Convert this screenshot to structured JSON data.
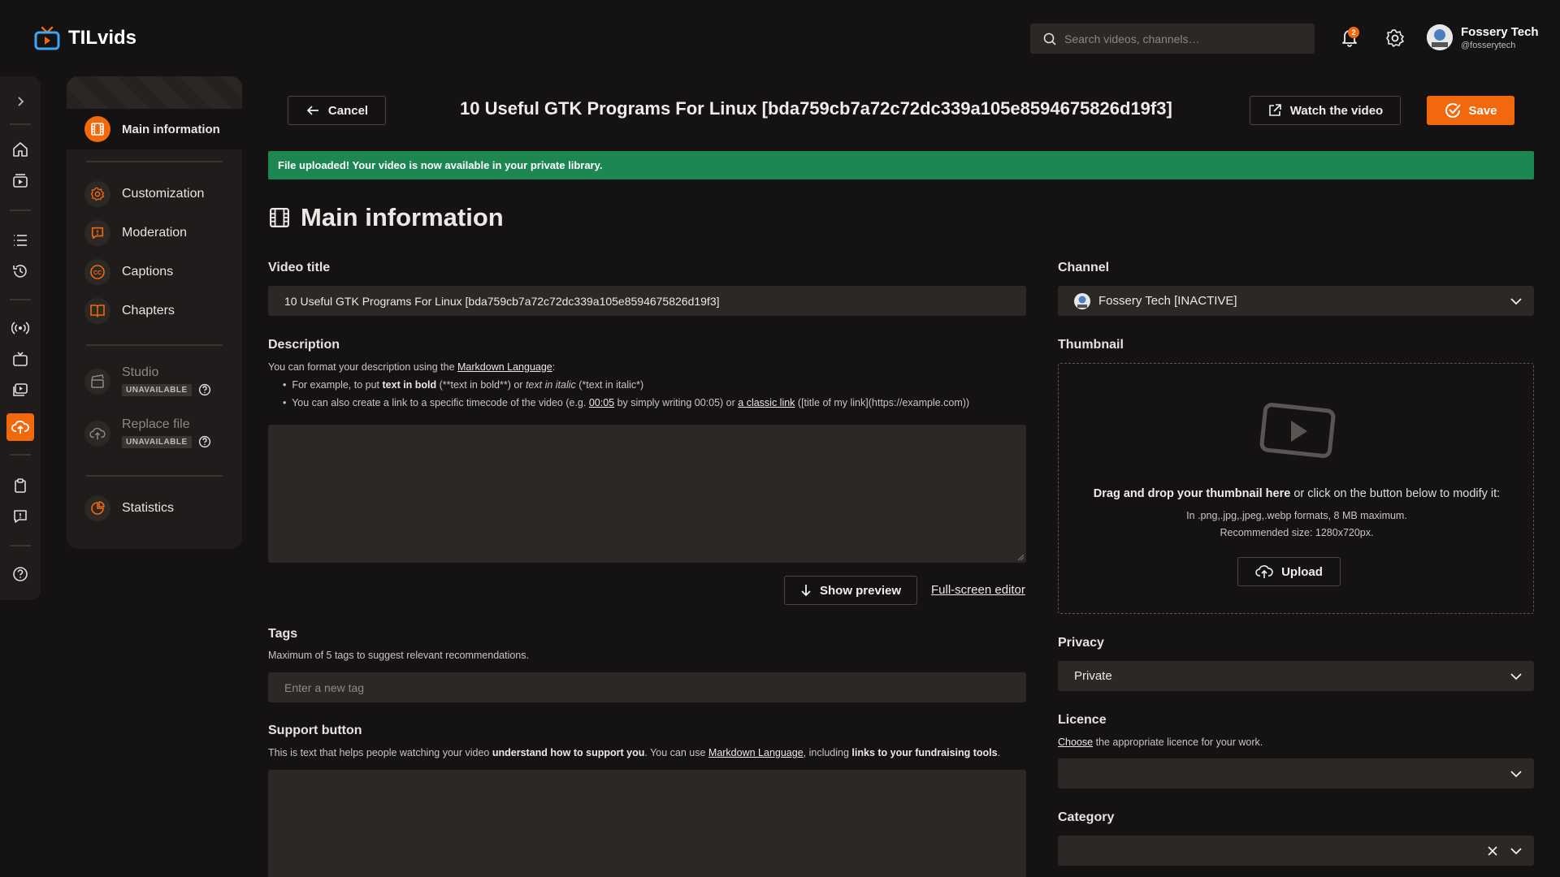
{
  "app": {
    "name": "TILvids"
  },
  "search": {
    "placeholder": "Search videos, channels…"
  },
  "notifications": {
    "count": "2"
  },
  "user": {
    "name": "Fossery Tech",
    "handle": "@fosserytech"
  },
  "submenu": {
    "main_information": "Main information",
    "customization": "Customization",
    "moderation": "Moderation",
    "captions": "Captions",
    "chapters": "Chapters",
    "studio": "Studio",
    "replace_file": "Replace file",
    "unavailable": "UNAVAILABLE",
    "statistics": "Statistics"
  },
  "header": {
    "cancel": "Cancel",
    "title": "10 Useful GTK Programs For Linux [bda759cb7a72c72dc339a105e8594675826d19f3]",
    "watch": "Watch the video",
    "save": "Save"
  },
  "alert": {
    "text": "File uploaded! Your video is now available in your private library."
  },
  "section": {
    "title": "Main information"
  },
  "form": {
    "video_title_label": "Video title",
    "video_title_value": "10 Useful GTK Programs For Linux [bda759cb7a72c72dc339a105e8594675826d19f3]",
    "description_label": "Description",
    "desc_hint_prefix": "You can format your description using the ",
    "desc_hint_link": "Markdown Language",
    "desc_hint_suffix": ":",
    "bullet1_a": "For example, to put ",
    "bullet1_bold": "text in bold",
    "bullet1_b": " (**text in bold**) or ",
    "bullet1_italic": "text in italic",
    "bullet1_c": " (*text in italic*)",
    "bullet2_a": "You can also create a link to a specific timecode of the video (e.g. ",
    "bullet2_time": "00:05",
    "bullet2_b": " by simply writing 00:05) or ",
    "bullet2_link": "a classic link",
    "bullet2_c": " ([title of my link](https://example.com))",
    "show_preview": "Show preview",
    "fullscreen_editor": "Full-screen editor",
    "tags_label": "Tags",
    "tags_hint": "Maximum of 5 tags to suggest relevant recommendations.",
    "tags_placeholder": "Enter a new tag",
    "support_label": "Support button",
    "support_a": "This is text that helps people watching your video ",
    "support_bold": "understand how to support you",
    "support_b": ". You can use ",
    "support_link": "Markdown Language",
    "support_c": ", including ",
    "support_bold2": "links to your fundraising tools",
    "support_d": "."
  },
  "right": {
    "channel_label": "Channel",
    "channel_value": "Fossery Tech [INACTIVE]",
    "thumbnail_label": "Thumbnail",
    "thumb_drag_bold": "Drag and drop your thumbnail here",
    "thumb_drag_rest": " or click on the button below to modify it:",
    "thumb_formats": "In .png,.jpg,.jpeg,.webp formats, 8 MB maximum.",
    "thumb_size": "Recommended size: 1280x720px.",
    "upload": "Upload",
    "privacy_label": "Privacy",
    "privacy_value": "Private",
    "licence_label": "Licence",
    "licence_link": "Choose",
    "licence_hint": " the appropriate licence for your work.",
    "category_label": "Category"
  },
  "colors": {
    "accent": "#f1680d",
    "success": "#1d8752",
    "background": "#141212",
    "panel": "#201c1b",
    "field": "#2c2826"
  }
}
